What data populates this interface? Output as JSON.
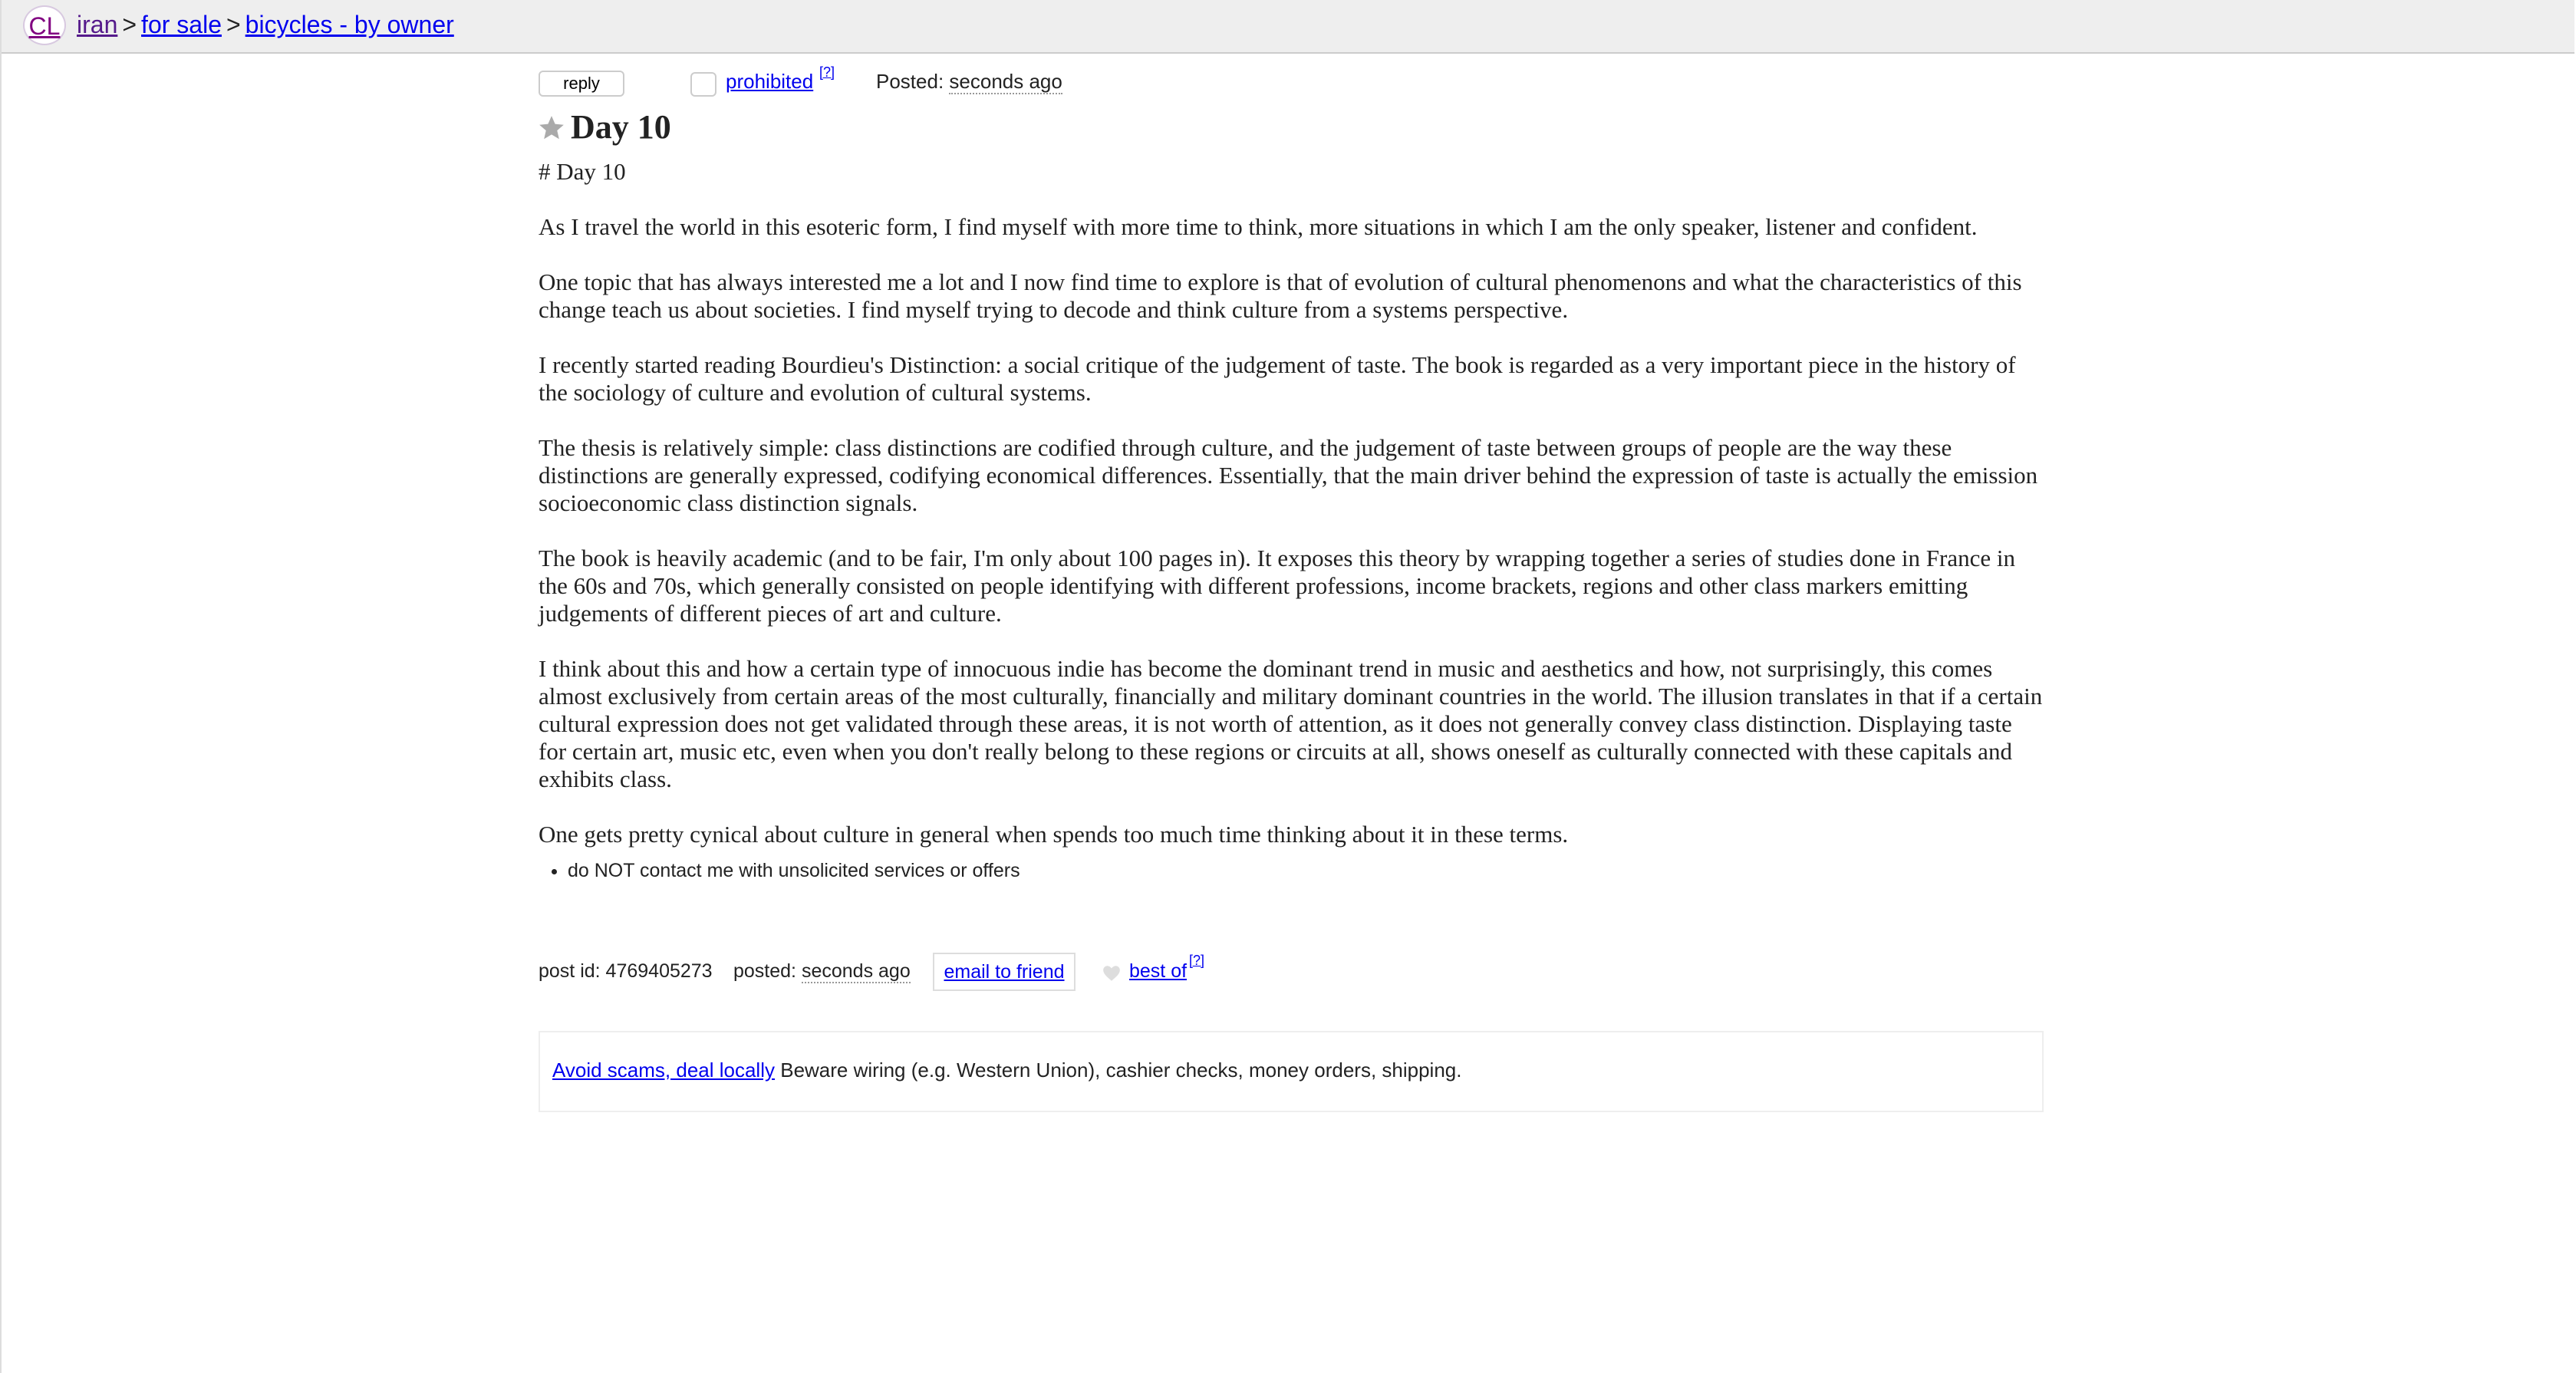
{
  "header": {
    "logo": "CL",
    "breadcrumb": [
      "iran",
      "for sale",
      "bicycles - by owner"
    ],
    "separator": ">"
  },
  "actions": {
    "reply": "reply",
    "prohibited": "prohibited",
    "help_sup": "[?]",
    "posted_label": "Posted:",
    "posted_time": "seconds ago"
  },
  "post": {
    "title": "Day 10",
    "paragraphs": [
      "# Day 10",
      "As I travel the world in this esoteric form, I find myself with more time to think, more situations in which I am the only speaker, listener and confident.",
      "One topic that has always interested me a lot and I now find time to explore is that of evolution of cultural phenomenons and what the characteristics of this change teach us about societies. I find myself trying to decode and think culture from a systems perspective.",
      "I recently started reading Bourdieu's Distinction: a social critique of the judgement of taste. The book is regarded as a very important piece in the history of the sociology of culture and evolution of cultural systems.",
      "The thesis is relatively simple: class distinctions are codified through culture, and the judgement of taste between groups of people are the way these distinctions are generally expressed, codifying economical differences. Essentially, that the main driver behind the expression of taste is actually the emission socioeconomic class distinction signals.",
      "The book is heavily academic (and to be fair, I'm only about 100 pages in). It exposes this theory by wrapping together a series of studies done in France in the 60s and 70s, which generally consisted on people identifying with different professions, income brackets, regions and other class markers emitting judgements of different pieces of art and culture.",
      "I think about this and how a certain type of innocuous indie has become the dominant trend in music and aesthetics and how, not surprisingly, this comes almost exclusively from certain areas of the most culturally, financially and military dominant countries in the world. The illusion translates in that if a certain cultural expression does not get validated through these areas, it is not worth of attention, as it does not generally convey class distinction. Displaying taste for certain art, music etc, even when you don't really belong to these regions or circuits at all, shows oneself as culturally connected with these capitals and exhibits class.",
      "One gets pretty cynical about culture in general when spends too much time thinking about it in these terms."
    ],
    "notice": "do NOT contact me with unsolicited services or offers"
  },
  "postinfo": {
    "id_label": "post id: 4769405273",
    "posted_label": "posted:",
    "posted_time": "seconds ago",
    "email_friend": "email to friend",
    "best_of": "best of",
    "help_sup": "[?]"
  },
  "scam": {
    "link": "Avoid scams, deal locally",
    "text": " Beware wiring (e.g. Western Union), cashier checks, money orders, shipping."
  },
  "colors": {
    "link": "#0000ee",
    "visited": "#551a8b",
    "topbar": "#eeeeee"
  }
}
